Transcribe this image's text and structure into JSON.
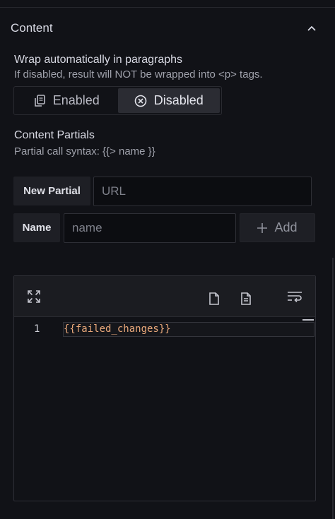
{
  "section": {
    "title": "Content",
    "collapse_icon": "chevron-up-icon"
  },
  "wrap": {
    "label": "Wrap automatically in paragraphs",
    "description": "If disabled, result will NOT be wrapped into <p> tags.",
    "options": [
      {
        "label": "Enabled",
        "icon": "document-copy-icon",
        "selected": false
      },
      {
        "label": "Disabled",
        "icon": "circle-x-icon",
        "selected": true
      }
    ]
  },
  "partials": {
    "label": "Content Partials",
    "description": "Partial call syntax: {{> name }}",
    "new_partial_label": "New Partial",
    "url_placeholder": "URL",
    "url_value": "",
    "name_label": "Name",
    "name_placeholder": "name",
    "name_value": "",
    "add_label": "Add"
  },
  "editor": {
    "line_numbers": [
      "1"
    ],
    "lines": [
      "{{failed_changes}}"
    ],
    "toolbar_icons": [
      "expand-icon",
      "file-icon",
      "file-text-icon",
      "wrap-text-icon"
    ]
  },
  "colors": {
    "background": "#111217",
    "accent_code": "#e9a87a",
    "selected_option": "#2b2c33"
  }
}
